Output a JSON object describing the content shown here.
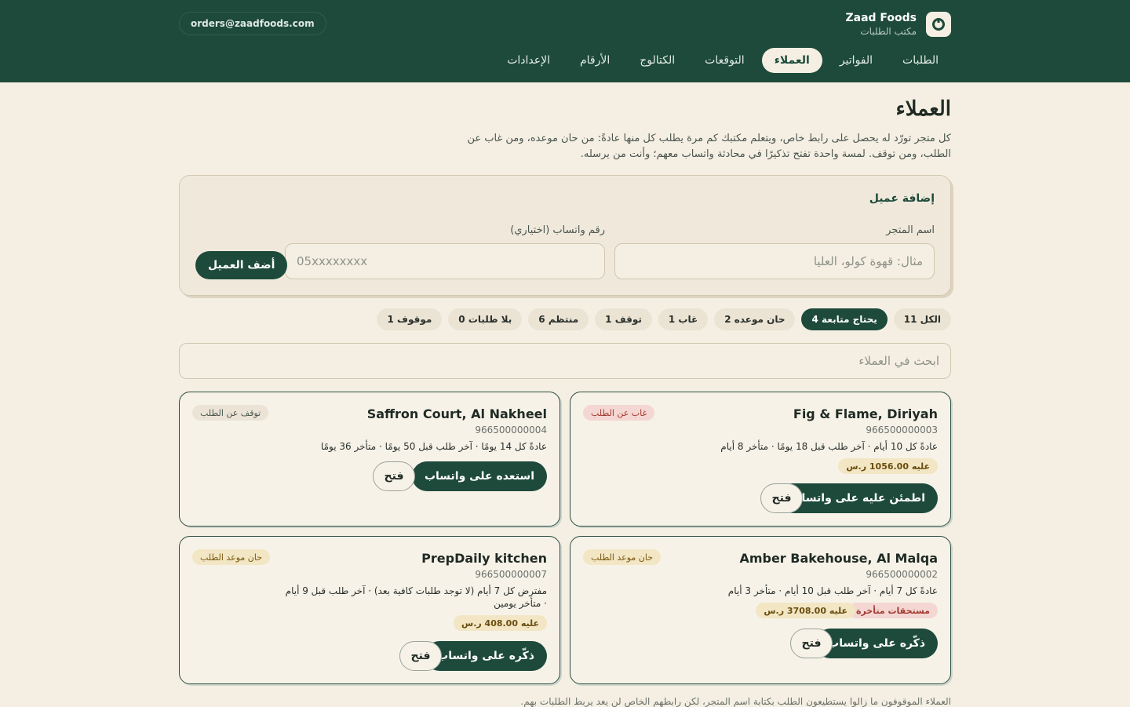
{
  "brand": {
    "name": "Zaad Foods",
    "subtitle": "مكتب الطلبات",
    "logo_icon": "spinner-logo-icon"
  },
  "header": {
    "email": "orders@zaadfoods.com"
  },
  "nav": {
    "items": [
      "الطلبات",
      "الفواتير",
      "العملاء",
      "التوقعات",
      "الكتالوج",
      "الأرقام",
      "الإعدادات"
    ],
    "active": "العملاء"
  },
  "page": {
    "title": "العملاء",
    "description": "كل متجر تورّد له يحصل على رابط خاص، ويتعلم مكتبك كم مرة يطلب كل منها عادةً: من حان موعده، ومن غاب عن الطلب، ومن توقف. لمسة واحدة تفتح تذكيرًا في محادثة واتساب معهم؛ وأنت من يرسله."
  },
  "add_customer": {
    "title": "إضافة عميل",
    "store_label": "اسم المتجر",
    "store_placeholder": "مثال: قهوة كولو، العليا",
    "phone_label": "رقم واتساب (اختياري)",
    "phone_placeholder": "05xxxxxxxx",
    "submit_label": "أضف العميل"
  },
  "filters": [
    {
      "label": "الكل 11",
      "active": false
    },
    {
      "label": "يحتاج متابعة 4",
      "active": true
    },
    {
      "label": "حان موعده 2",
      "active": false
    },
    {
      "label": "غاب 1",
      "active": false
    },
    {
      "label": "توقف 1",
      "active": false
    },
    {
      "label": "منتظم 6",
      "active": false
    },
    {
      "label": "بلا طلبات 0",
      "active": false
    },
    {
      "label": "موقوف 1",
      "active": false
    }
  ],
  "search": {
    "placeholder": "ابحث في العملاء"
  },
  "customers": [
    {
      "name": "Fig & Flame, Diriyah",
      "phone": "966500000003",
      "info": "عادةً كل 10 أيام · آخر طلب قبل 18 يومًا · متأخر 8 أيام",
      "status": "غاب عن الطلب",
      "balance": "عليه 1056.00 ر.س",
      "action": "اطمئن عليه على واتساب",
      "open": "فتح"
    },
    {
      "name": "Saffron Court, Al Nakheel",
      "phone": "966500000004",
      "info": "عادةً كل 14 يومًا · آخر طلب قبل 50 يومًا · متأخر 36 يومًا",
      "status": "توقف عن الطلب",
      "action": "استعده على واتساب",
      "open": "فتح"
    },
    {
      "name": "Amber Bakehouse, Al Malqa",
      "phone": "966500000002",
      "info": "عادةً كل 7 أيام · آخر طلب قبل 10 أيام · متأخر 3 أيام",
      "status": "حان موعد الطلب",
      "overdue": "مستحقات متأخرة",
      "balance": "عليه 3708.00 ر.س",
      "action": "ذكّره على واتساب",
      "open": "فتح"
    },
    {
      "name": "PrepDaily kitchen",
      "phone": "966500000007",
      "info": "مفترض كل 7 أيام (لا توجد طلبات كافية بعد) · آخر طلب قبل 9 أيام · متأخر يومين",
      "status": "حان موعد الطلب",
      "balance": "عليه 408.00 ر.س",
      "action": "ذكّره على واتساب",
      "open": "فتح"
    }
  ],
  "footnote": "العملاء الموقوفون ما زالوا يستطيعون الطلب بكتابة اسم المتجر، لكن رابطهم الخاص لن يعد يربط الطلبات بهم.",
  "colors": {
    "header": "#1d4a3b",
    "background": "#f5efe3",
    "accent": "#1d4a3b"
  }
}
